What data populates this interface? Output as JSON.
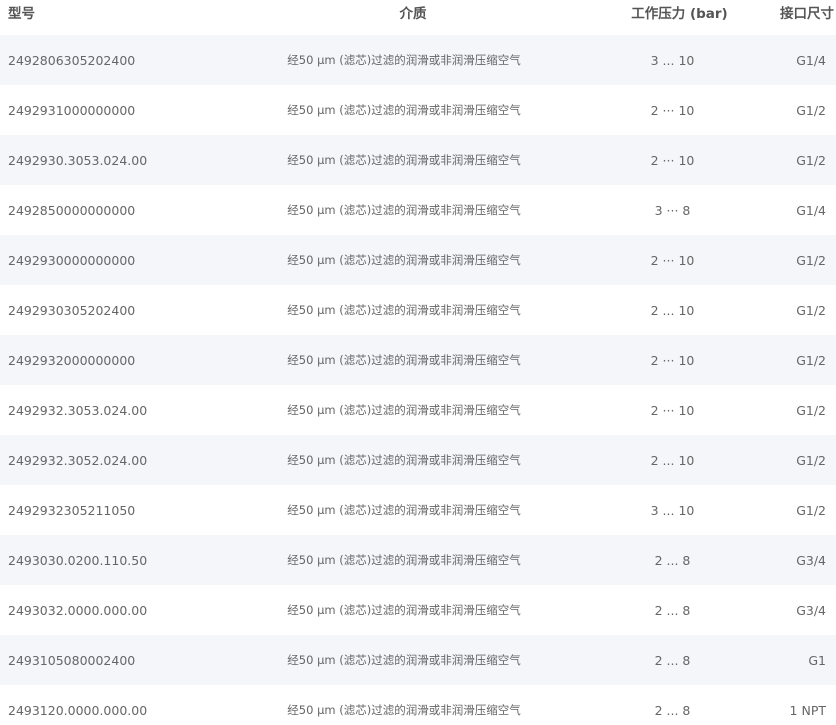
{
  "header": {
    "model": "型号",
    "medium": "介质",
    "pressure": "工作压力 (bar)",
    "port": "接口尺寸"
  },
  "rows": [
    {
      "model": "2492806305202400",
      "medium": "经50 μm (滤芯)过滤的润滑或非润滑压缩空气",
      "pressure": "3 ... 10",
      "port": "G1/4"
    },
    {
      "model": "2492931000000000",
      "medium": "经50 μm (滤芯)过滤的润滑或非润滑压缩空气",
      "pressure": "2 ··· 10",
      "port": "G1/2"
    },
    {
      "model": "2492930.3053.024.00",
      "medium": "经50 μm (滤芯)过滤的润滑或非润滑压缩空气",
      "pressure": "2 ··· 10",
      "port": "G1/2"
    },
    {
      "model": "2492850000000000",
      "medium": "经50 μm (滤芯)过滤的润滑或非润滑压缩空气",
      "pressure": "3 ··· 8",
      "port": "G1/4"
    },
    {
      "model": "2492930000000000",
      "medium": "经50 μm (滤芯)过滤的润滑或非润滑压缩空气",
      "pressure": "2 ··· 10",
      "port": "G1/2"
    },
    {
      "model": "2492930305202400",
      "medium": "经50 μm (滤芯)过滤的润滑或非润滑压缩空气",
      "pressure": "2 ... 10",
      "port": "G1/2"
    },
    {
      "model": "2492932000000000",
      "medium": "经50 μm (滤芯)过滤的润滑或非润滑压缩空气",
      "pressure": "2 ··· 10",
      "port": "G1/2"
    },
    {
      "model": "2492932.3053.024.00",
      "medium": "经50 μm (滤芯)过滤的润滑或非润滑压缩空气",
      "pressure": "2 ··· 10",
      "port": "G1/2"
    },
    {
      "model": "2492932.3052.024.00",
      "medium": "经50 μm (滤芯)过滤的润滑或非润滑压缩空气",
      "pressure": "2 ... 10",
      "port": "G1/2"
    },
    {
      "model": "2492932305211050",
      "medium": "经50 μm (滤芯)过滤的润滑或非润滑压缩空气",
      "pressure": "3 ... 10",
      "port": "G1/2"
    },
    {
      "model": "2493030.0200.110.50",
      "medium": "经50 μm (滤芯)过滤的润滑或非润滑压缩空气",
      "pressure": "2 ... 8",
      "port": "G3/4"
    },
    {
      "model": "2493032.0000.000.00",
      "medium": "经50 μm (滤芯)过滤的润滑或非润滑压缩空气",
      "pressure": "2 ... 8",
      "port": "G3/4"
    },
    {
      "model": "2493105080002400",
      "medium": "经50 μm (滤芯)过滤的润滑或非润滑压缩空气",
      "pressure": "2 ... 8",
      "port": "G1"
    },
    {
      "model": "2493120.0000.000.00",
      "medium": "经50 μm (滤芯)过滤的润滑或非润滑压缩空气",
      "pressure": "2 ... 8",
      "port": "1 NPT"
    }
  ]
}
